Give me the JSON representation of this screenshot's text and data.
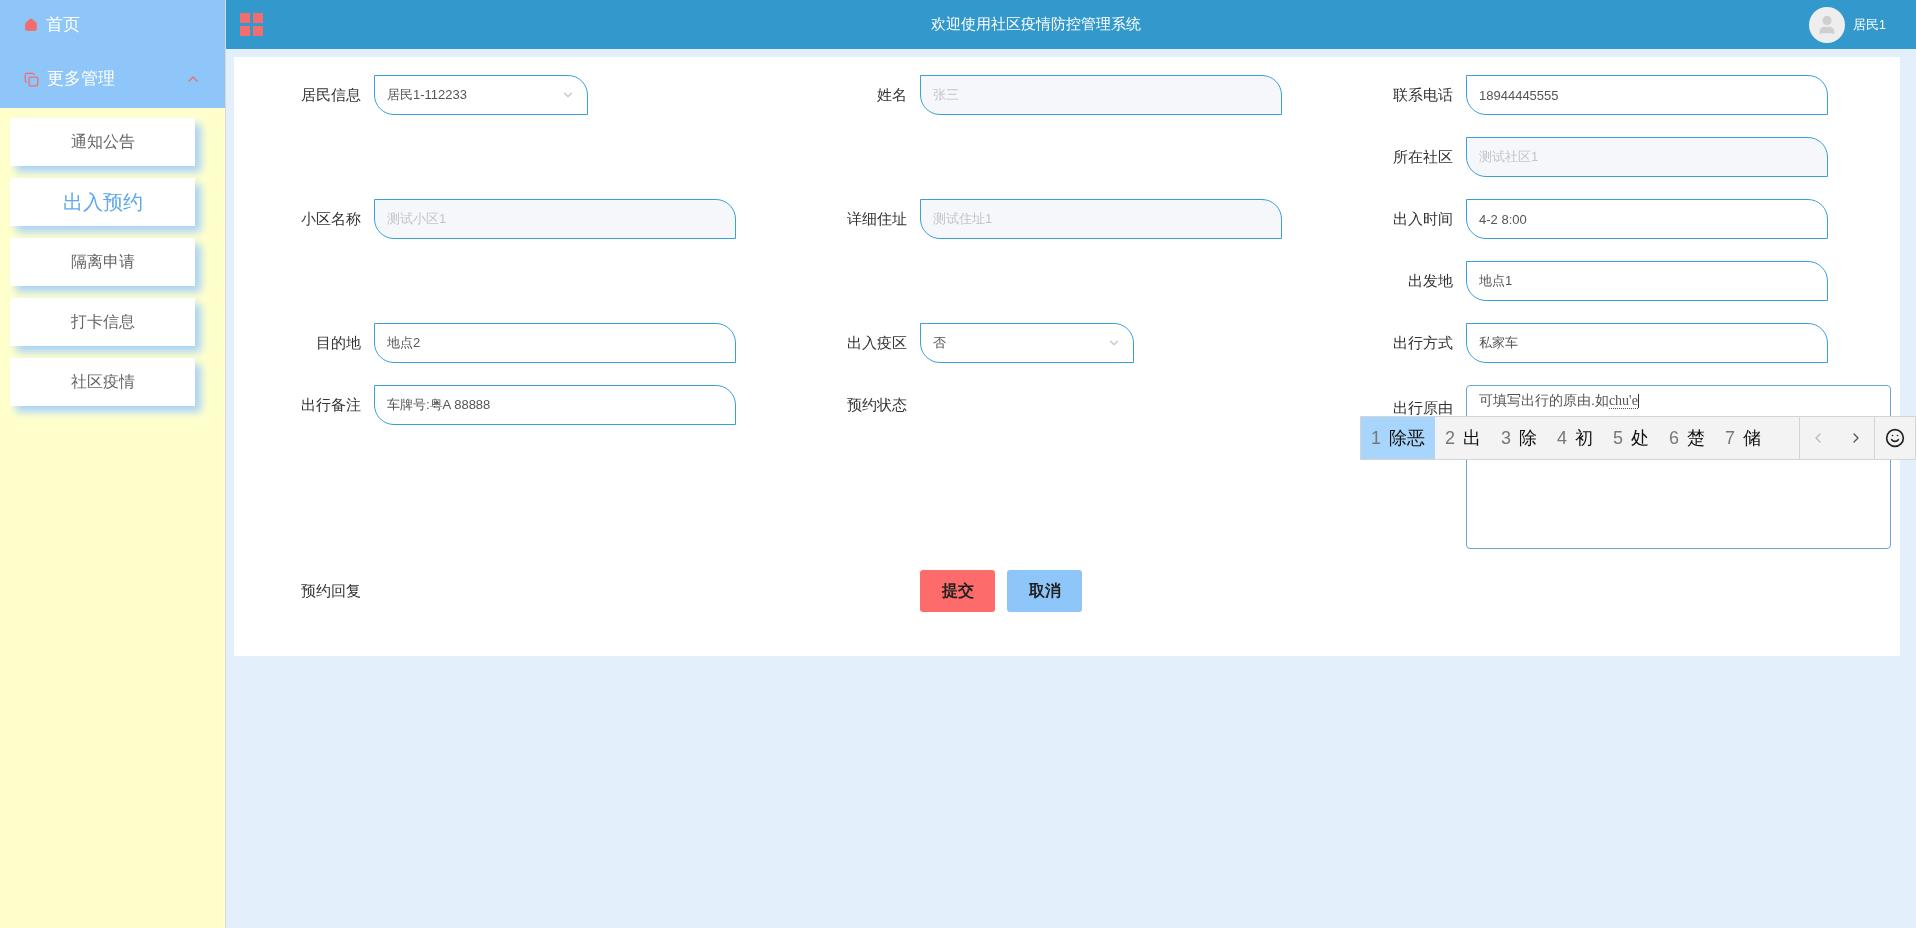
{
  "header": {
    "title": "欢迎使用社区疫情防控管理系统",
    "user": "居民1"
  },
  "sidebar": {
    "items": [
      {
        "label": "首页",
        "kind": "home"
      },
      {
        "label": "更多管理",
        "kind": "group",
        "expanded": true,
        "children": [
          {
            "label": "通知公告",
            "selected": false
          },
          {
            "label": "出入预约",
            "selected": true
          },
          {
            "label": "隔离申请",
            "selected": false
          },
          {
            "label": "打卡信息",
            "selected": false
          },
          {
            "label": "社区疫情",
            "selected": false
          }
        ]
      }
    ]
  },
  "form": {
    "fields": [
      {
        "label": "居民信息",
        "kind": "select",
        "value": "居民1-112233",
        "disabled": false
      },
      {
        "label": "姓名",
        "kind": "text",
        "value": "张三",
        "disabled": true
      },
      {
        "label": "联系电话",
        "kind": "text",
        "value": "18944445555",
        "disabled": false
      },
      {
        "label": "所在社区",
        "kind": "text",
        "value": "测试社区1",
        "disabled": true
      },
      {
        "label": "小区名称",
        "kind": "text",
        "value": "测试小区1",
        "disabled": true
      },
      {
        "label": "详细住址",
        "kind": "text",
        "value": "测试住址1",
        "disabled": true
      },
      {
        "label": "出入时间",
        "kind": "text",
        "value": "4-2 8:00",
        "disabled": false
      },
      {
        "label": "出发地",
        "kind": "text",
        "value": "地点1",
        "disabled": false
      },
      {
        "label": "目的地",
        "kind": "text",
        "value": "地点2",
        "disabled": false
      },
      {
        "label": "出入疫区",
        "kind": "select",
        "value": "否",
        "disabled": false
      },
      {
        "label": "出行方式",
        "kind": "text",
        "value": "私家车",
        "disabled": false
      },
      {
        "label": "出行备注",
        "kind": "text",
        "value": "车牌号:粤A 88888",
        "disabled": false
      },
      {
        "label": "预约状态",
        "kind": "none"
      },
      {
        "label": "出行原由",
        "kind": "textarea",
        "value": "可填写出行的原由.如",
        "composition": "chu'e"
      },
      {
        "label": "预约回复",
        "kind": "none"
      }
    ],
    "buttons": [
      {
        "label": "提交",
        "kind": "primary"
      },
      {
        "label": "取消",
        "kind": "secondary"
      }
    ]
  },
  "ime": {
    "candidates": [
      {
        "number": "1",
        "text": "除恶",
        "selected": true
      },
      {
        "number": "2",
        "text": "出",
        "selected": false
      },
      {
        "number": "3",
        "text": "除",
        "selected": false
      },
      {
        "number": "4",
        "text": "初",
        "selected": false
      },
      {
        "number": "5",
        "text": "处",
        "selected": false
      },
      {
        "number": "6",
        "text": "楚",
        "selected": false
      },
      {
        "number": "7",
        "text": "储",
        "selected": false
      }
    ]
  }
}
